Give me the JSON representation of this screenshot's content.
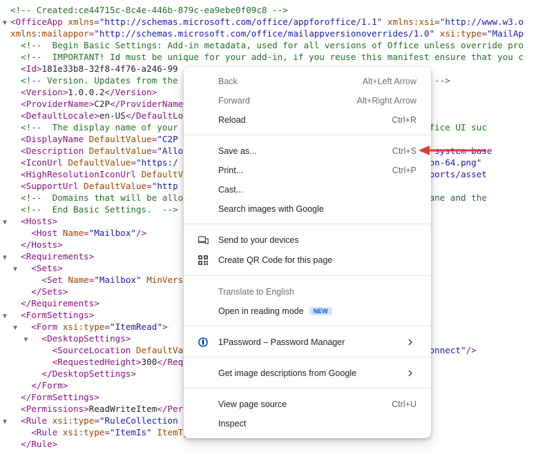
{
  "xml_source": {
    "lines": [
      {
        "fold": "",
        "parts": [
          {
            "c": "cm",
            "t": "<!-- Created:ce44715c-8c4e-446b-879c-ea9ebe0f09c8 -->"
          }
        ]
      },
      {
        "fold": "▼",
        "parts": [
          {
            "c": "tg",
            "t": "<OfficeApp "
          },
          {
            "c": "at",
            "t": "xmlns"
          },
          {
            "c": "tg",
            "t": "="
          },
          {
            "c": "av",
            "t": "\"http://schemas.microsoft.com/office/appforoffice/1.1\""
          },
          {
            "c": "tg",
            "t": " "
          },
          {
            "c": "at",
            "t": "xmlns:xsi"
          },
          {
            "c": "tg",
            "t": "="
          },
          {
            "c": "av",
            "t": "\"http://www.w3.o"
          }
        ]
      },
      {
        "fold": "",
        "parts": [
          {
            "c": "at",
            "t": "xmlns:mailappor"
          },
          {
            "c": "tg",
            "t": "="
          },
          {
            "c": "av",
            "t": "\"http://schemas.microsoft.com/office/mailappversionoverrides/1.0\""
          },
          {
            "c": "tg",
            "t": " "
          },
          {
            "c": "at",
            "t": "xsi:type"
          },
          {
            "c": "tg",
            "t": "="
          },
          {
            "c": "av",
            "t": "\"MailAp"
          }
        ]
      },
      {
        "fold": "",
        "parts": [
          {
            "c": "cm",
            "t": "  <!--  Begin Basic Settings: Add-in metadata, used for all versions of Office unless override pro"
          }
        ]
      },
      {
        "fold": "",
        "parts": [
          {
            "c": "cm",
            "t": "  <!--  IMPORTANT! Id must be unique for your add-in, if you reuse this manifest ensure that you c"
          }
        ]
      },
      {
        "fold": "",
        "parts": [
          {
            "c": "tg",
            "t": "  <Id>"
          },
          {
            "c": "tx",
            "t": "181e33b8-32f8-4f76-a246-99"
          }
        ]
      },
      {
        "fold": "",
        "parts": [
          {
            "c": "cm",
            "t": "  <!-- Version. Updates from the                                     on change.  -->"
          }
        ]
      },
      {
        "fold": "",
        "parts": [
          {
            "c": "tg",
            "t": "  <Version>"
          },
          {
            "c": "tx",
            "t": "1.0.0.2"
          },
          {
            "c": "tg",
            "t": "</Version>"
          }
        ]
      },
      {
        "fold": "",
        "parts": [
          {
            "c": "tg",
            "t": "  <ProviderName>"
          },
          {
            "c": "tx",
            "t": "C2P"
          },
          {
            "c": "tg",
            "t": "</ProviderName"
          }
        ]
      },
      {
        "fold": "",
        "parts": [
          {
            "c": "tg",
            "t": "  <DefaultLocale>"
          },
          {
            "c": "tx",
            "t": "en-US"
          },
          {
            "c": "tg",
            "t": "</DefaultLo"
          }
        ]
      },
      {
        "fold": "",
        "parts": [
          {
            "c": "cm",
            "t": "  <!--  The display name of your                                       of the Office UI suc"
          }
        ]
      },
      {
        "fold": "",
        "parts": [
          {
            "c": "tg",
            "t": "  <DisplayName "
          },
          {
            "c": "at",
            "t": "DefaultValue"
          },
          {
            "c": "tg",
            "t": "="
          },
          {
            "c": "av",
            "t": "\"C2P"
          }
        ]
      },
      {
        "fold": "",
        "parts": [
          {
            "c": "tg",
            "t": "  <Description "
          },
          {
            "c": "at",
            "t": "DefaultValue"
          },
          {
            "c": "tg",
            "t": "="
          },
          {
            "c": "av",
            "t": "\"Allo                                      n the C2P system base"
          }
        ]
      },
      {
        "fold": "",
        "parts": [
          {
            "c": "tg",
            "t": "  <IconUrl "
          },
          {
            "c": "at",
            "t": "DefaultValue"
          },
          {
            "c": "tg",
            "t": "="
          },
          {
            "c": "av",
            "t": "\"https:/                                      /assets/icon-64.png\""
          }
        ]
      },
      {
        "fold": "",
        "parts": [
          {
            "c": "tg",
            "t": "  <HighResolutionIconUrl "
          },
          {
            "c": "at",
            "t": "DefaultV"
          },
          {
            "c": "av",
            "t": "                                      /OfficeReports/asset"
          }
        ]
      },
      {
        "fold": "",
        "parts": [
          {
            "c": "tg",
            "t": "  <SupportUrl "
          },
          {
            "c": "at",
            "t": "DefaultValue"
          },
          {
            "c": "tg",
            "t": "="
          },
          {
            "c": "av",
            "t": "\"http"
          }
        ]
      },
      {
        "fold": "",
        "parts": [
          {
            "c": "cm",
            "t": "  <!--  Domains that will be allo                                      ShowTaskpane and the"
          }
        ]
      },
      {
        "fold": "",
        "parts": [
          {
            "c": "cm",
            "t": "  <!--  End Basic Settings.  -->"
          }
        ]
      },
      {
        "fold": "▼",
        "parts": [
          {
            "c": "tg",
            "t": "  <Hosts>"
          }
        ]
      },
      {
        "fold": "",
        "parts": [
          {
            "c": "tg",
            "t": "    <Host "
          },
          {
            "c": "at",
            "t": "Name"
          },
          {
            "c": "tg",
            "t": "="
          },
          {
            "c": "av",
            "t": "\"Mailbox\""
          },
          {
            "c": "tg",
            "t": "/>"
          }
        ]
      },
      {
        "fold": "",
        "parts": [
          {
            "c": "tg",
            "t": "  </Hosts>"
          }
        ]
      },
      {
        "fold": "▼",
        "parts": [
          {
            "c": "tg",
            "t": "  <Requirements>"
          }
        ]
      },
      {
        "fold": "  ▼",
        "parts": [
          {
            "c": "tg",
            "t": "  <Sets>"
          }
        ]
      },
      {
        "fold": "",
        "parts": [
          {
            "c": "tg",
            "t": "      <Set "
          },
          {
            "c": "at",
            "t": "Name"
          },
          {
            "c": "tg",
            "t": "="
          },
          {
            "c": "av",
            "t": "\"Mailbox\""
          },
          {
            "c": "tg",
            "t": " "
          },
          {
            "c": "at",
            "t": "MinVers"
          }
        ]
      },
      {
        "fold": "",
        "parts": [
          {
            "c": "tg",
            "t": "    </Sets>"
          }
        ]
      },
      {
        "fold": "",
        "parts": [
          {
            "c": "tg",
            "t": "  </Requirements>"
          }
        ]
      },
      {
        "fold": "▼",
        "parts": [
          {
            "c": "tg",
            "t": "  <FormSettings>"
          }
        ]
      },
      {
        "fold": "  ▼",
        "parts": [
          {
            "c": "tg",
            "t": "  <Form "
          },
          {
            "c": "at",
            "t": "xsi:type"
          },
          {
            "c": "tg",
            "t": "="
          },
          {
            "c": "av",
            "t": "\"ItemRead\""
          },
          {
            "c": "tg",
            "t": ">"
          }
        ]
      },
      {
        "fold": "    ▼",
        "parts": [
          {
            "c": "tg",
            "t": "  <DesktopSettings>"
          }
        ]
      },
      {
        "fold": "",
        "parts": [
          {
            "c": "tg",
            "t": "        <SourceLocation "
          },
          {
            "c": "at",
            "t": "DefaultVa"
          },
          {
            "c": "av",
            "t": "                                      /ContactConnect\""
          },
          {
            "c": "tg",
            "t": "/>"
          }
        ]
      },
      {
        "fold": "",
        "parts": [
          {
            "c": "tg",
            "t": "        <RequestedHeight>"
          },
          {
            "c": "tx",
            "t": "300"
          },
          {
            "c": "tg",
            "t": "</Req"
          }
        ]
      },
      {
        "fold": "",
        "parts": [
          {
            "c": "tg",
            "t": "      </DesktopSettings>"
          }
        ]
      },
      {
        "fold": "",
        "parts": [
          {
            "c": "tg",
            "t": "    </Form>"
          }
        ]
      },
      {
        "fold": "",
        "parts": [
          {
            "c": "tg",
            "t": "  </FormSettings>"
          }
        ]
      },
      {
        "fold": "",
        "parts": [
          {
            "c": "tg",
            "t": "  <Permissions>"
          },
          {
            "c": "tx",
            "t": "ReadWriteItem"
          },
          {
            "c": "tg",
            "t": "</Per"
          }
        ]
      },
      {
        "fold": "▼",
        "parts": [
          {
            "c": "tg",
            "t": "  <Rule "
          },
          {
            "c": "at",
            "t": "xsi:type"
          },
          {
            "c": "tg",
            "t": "="
          },
          {
            "c": "av",
            "t": "\"RuleCollection"
          }
        ]
      },
      {
        "fold": "",
        "parts": [
          {
            "c": "tg",
            "t": "    <Rule "
          },
          {
            "c": "at",
            "t": "xsi:type"
          },
          {
            "c": "tg",
            "t": "="
          },
          {
            "c": "av",
            "t": "\"ItemIs\""
          },
          {
            "c": "tg",
            "t": " "
          },
          {
            "c": "at",
            "t": "ItemType"
          },
          {
            "c": "tg",
            "t": "="
          },
          {
            "c": "av",
            "t": "\"Message\""
          },
          {
            "c": "tg",
            "t": " "
          },
          {
            "c": "at",
            "t": "FormType"
          },
          {
            "c": "tg",
            "t": "="
          },
          {
            "c": "av",
            "t": "\"Read\""
          },
          {
            "c": "tg",
            "t": "/>"
          }
        ]
      },
      {
        "fold": "",
        "parts": [
          {
            "c": "tg",
            "t": "  </Rule>"
          }
        ]
      }
    ]
  },
  "context_menu": {
    "items": {
      "back": {
        "label": "Back",
        "shortcut": "Alt+Left Arrow",
        "disabled": true
      },
      "forward": {
        "label": "Forward",
        "shortcut": "Alt+Right Arrow",
        "disabled": true
      },
      "reload": {
        "label": "Reload",
        "shortcut": "Ctrl+R"
      },
      "save_as": {
        "label": "Save as...",
        "shortcut": "Ctrl+S"
      },
      "print": {
        "label": "Print...",
        "shortcut": "Ctrl+P"
      },
      "cast": {
        "label": "Cast..."
      },
      "search_images": {
        "label": "Search images with Google"
      },
      "send_devices": {
        "label": "Send to your devices",
        "icon": "laptop-phone-icon"
      },
      "qr_code": {
        "label": "Create QR Code for this page",
        "icon": "qr-code-icon"
      },
      "translate": {
        "label": "Translate to English",
        "disabled": true
      },
      "reading_mode": {
        "label": "Open in reading mode",
        "badge": "NEW"
      },
      "password": {
        "label": "1Password – Password Manager",
        "icon": "1password-icon"
      },
      "image_desc": {
        "label": "Get image descriptions from Google"
      },
      "view_source": {
        "label": "View page source",
        "shortcut": "Ctrl+U"
      },
      "inspect": {
        "label": "Inspect"
      }
    }
  },
  "colors": {
    "annotation_arrow": "#e53935",
    "badge_bg": "#d3e3fd",
    "badge_text": "#0b57d0",
    "onepassword_blue": "#1a73e8"
  }
}
